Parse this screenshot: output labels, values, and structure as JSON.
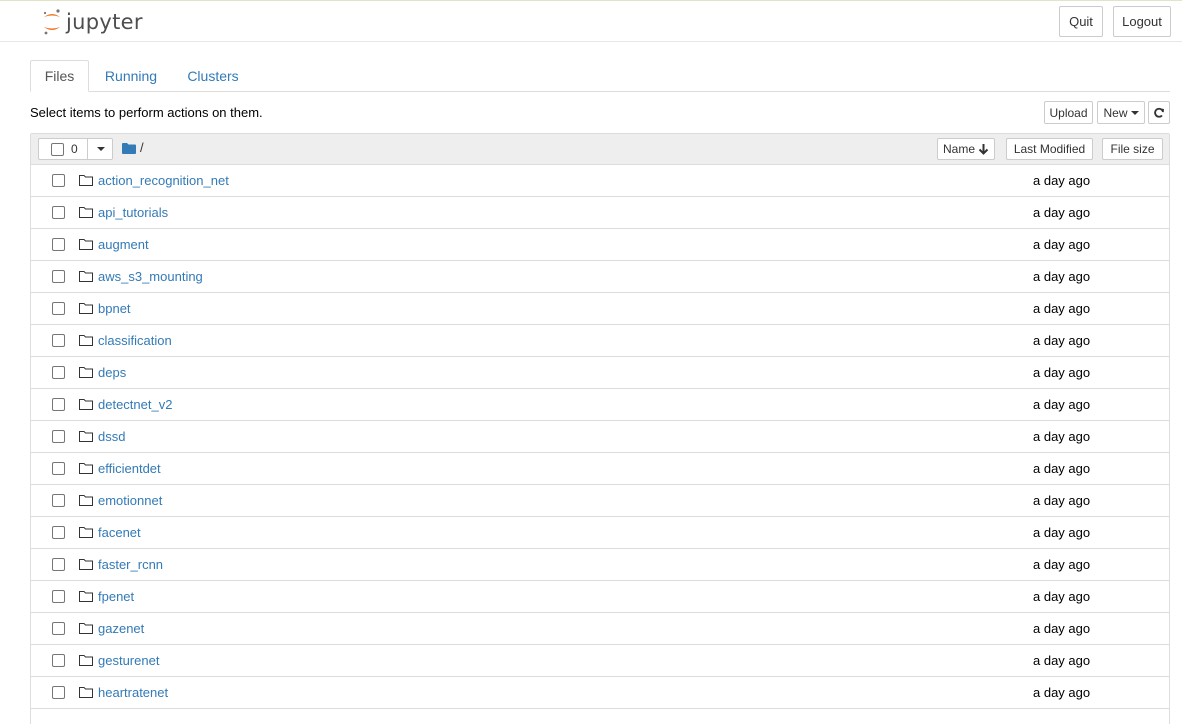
{
  "header": {
    "logo_text": "jupyter",
    "quit_label": "Quit",
    "logout_label": "Logout"
  },
  "tabs": [
    {
      "label": "Files",
      "active": true
    },
    {
      "label": "Running",
      "active": false
    },
    {
      "label": "Clusters",
      "active": false
    }
  ],
  "toolbar": {
    "select_message": "Select items to perform actions on them.",
    "upload_label": "Upload",
    "new_label": "New"
  },
  "list_header": {
    "selected_count": "0",
    "breadcrumb_root": "/",
    "sort_name_label": "Name",
    "last_modified_label": "Last Modified",
    "file_size_label": "File size"
  },
  "files": [
    {
      "name": "action_recognition_net",
      "modified": "a day ago"
    },
    {
      "name": "api_tutorials",
      "modified": "a day ago"
    },
    {
      "name": "augment",
      "modified": "a day ago"
    },
    {
      "name": "aws_s3_mounting",
      "modified": "a day ago"
    },
    {
      "name": "bpnet",
      "modified": "a day ago"
    },
    {
      "name": "classification",
      "modified": "a day ago"
    },
    {
      "name": "deps",
      "modified": "a day ago"
    },
    {
      "name": "detectnet_v2",
      "modified": "a day ago"
    },
    {
      "name": "dssd",
      "modified": "a day ago"
    },
    {
      "name": "efficientdet",
      "modified": "a day ago"
    },
    {
      "name": "emotionnet",
      "modified": "a day ago"
    },
    {
      "name": "facenet",
      "modified": "a day ago"
    },
    {
      "name": "faster_rcnn",
      "modified": "a day ago"
    },
    {
      "name": "fpenet",
      "modified": "a day ago"
    },
    {
      "name": "gazenet",
      "modified": "a day ago"
    },
    {
      "name": "gesturenet",
      "modified": "a day ago"
    },
    {
      "name": "heartratenet",
      "modified": "a day ago"
    }
  ],
  "icons": {
    "row_icon": "folder-icon",
    "breadcrumb_icon": "folder-icon",
    "refresh_icon": "refresh-icon",
    "sort_icon": "arrow-down-icon"
  },
  "colors": {
    "link": "#337ab7",
    "logo_orange": "#f37726",
    "logo_gray": "#767677"
  }
}
